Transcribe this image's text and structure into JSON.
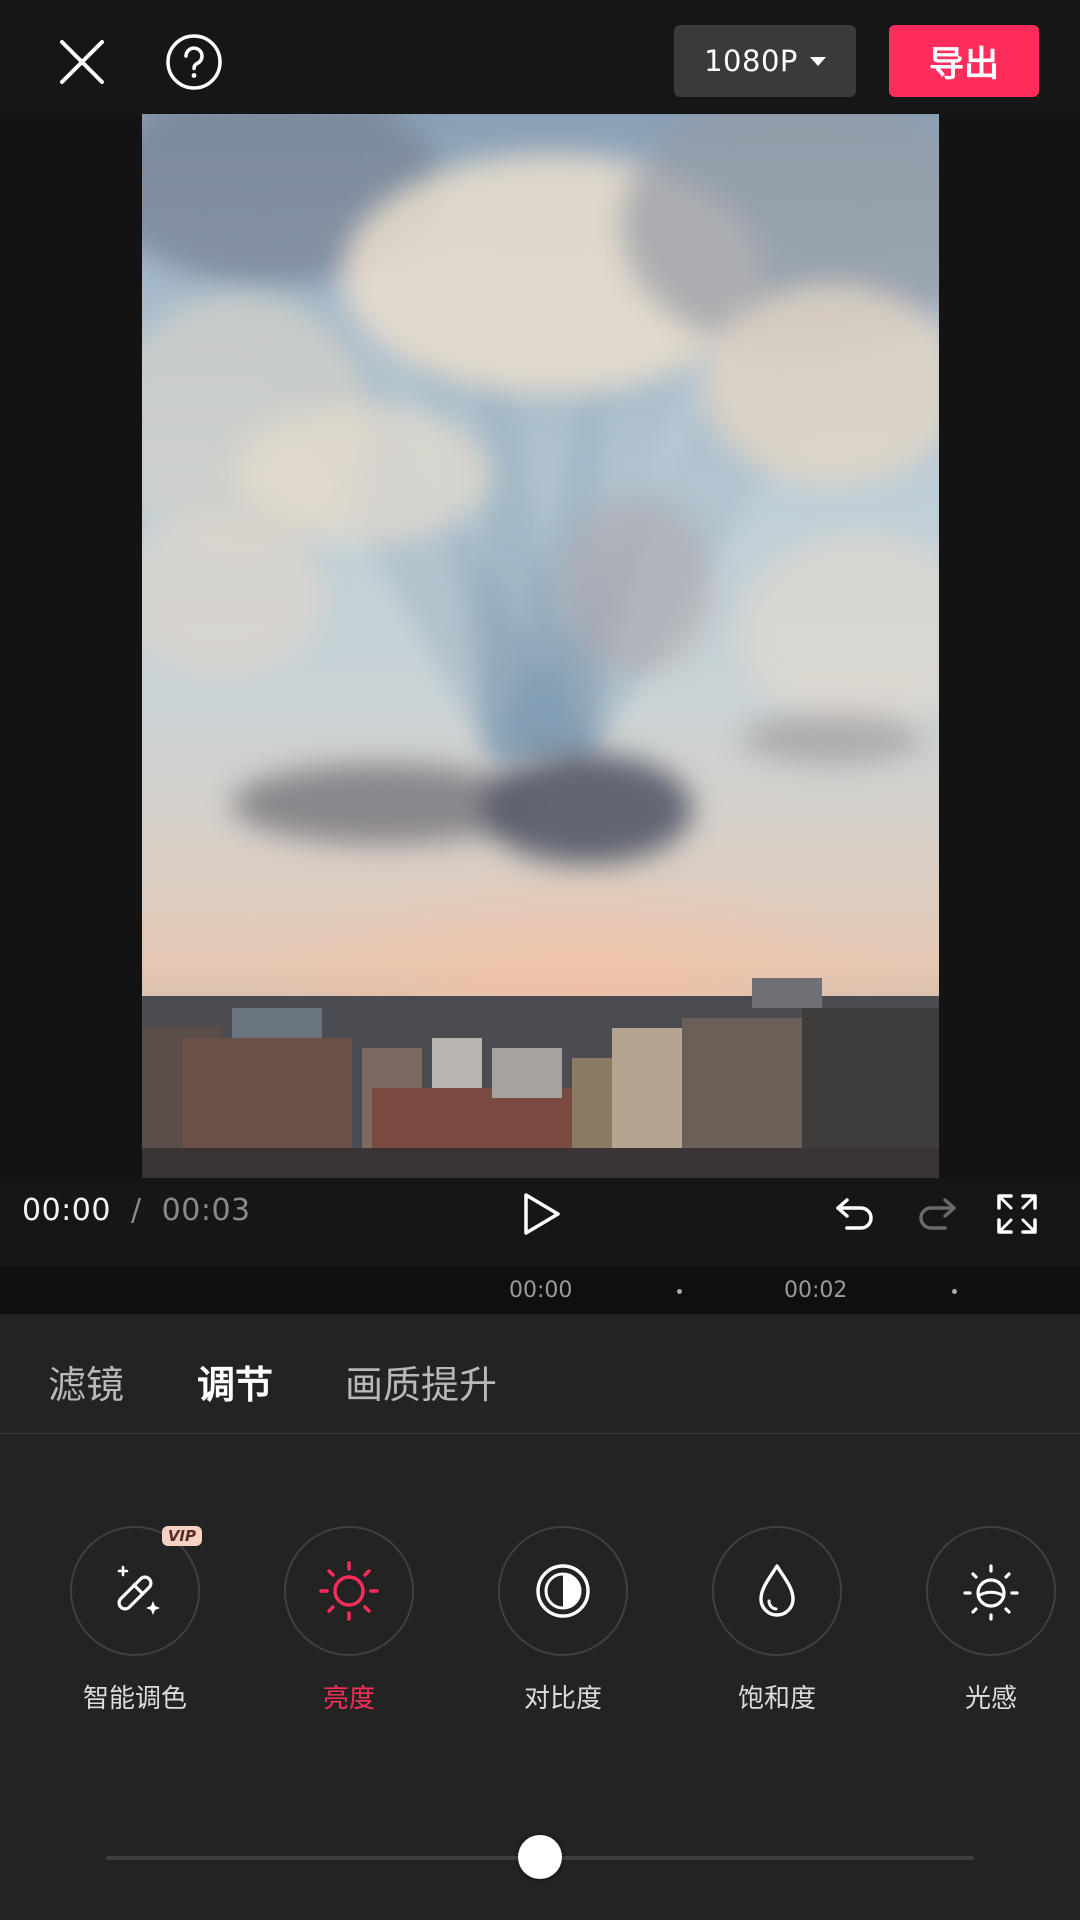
{
  "toolbar": {
    "resolution": "1080P",
    "export_label": "导出"
  },
  "player": {
    "current_time": "00:00",
    "separator": "/",
    "total_time": "00:03"
  },
  "timeline": {
    "ticks": [
      "00:00",
      "00:02"
    ]
  },
  "tabs": [
    {
      "label": "滤镜",
      "active": false
    },
    {
      "label": "调节",
      "active": true
    },
    {
      "label": "画质提升",
      "active": false
    }
  ],
  "tools": [
    {
      "label": "智能调色",
      "icon": "magic-wand-icon",
      "badge": "VIP",
      "active": false
    },
    {
      "label": "亮度",
      "icon": "sun-icon",
      "active": true
    },
    {
      "label": "对比度",
      "icon": "contrast-icon",
      "active": false
    },
    {
      "label": "饱和度",
      "icon": "droplet-icon",
      "active": false
    },
    {
      "label": "光感",
      "icon": "light-sense-icon",
      "active": false
    }
  ],
  "slider": {
    "value": 0.5
  },
  "colors": {
    "accent": "#fd2c5a",
    "background": "#161616",
    "panel": "#232323"
  }
}
